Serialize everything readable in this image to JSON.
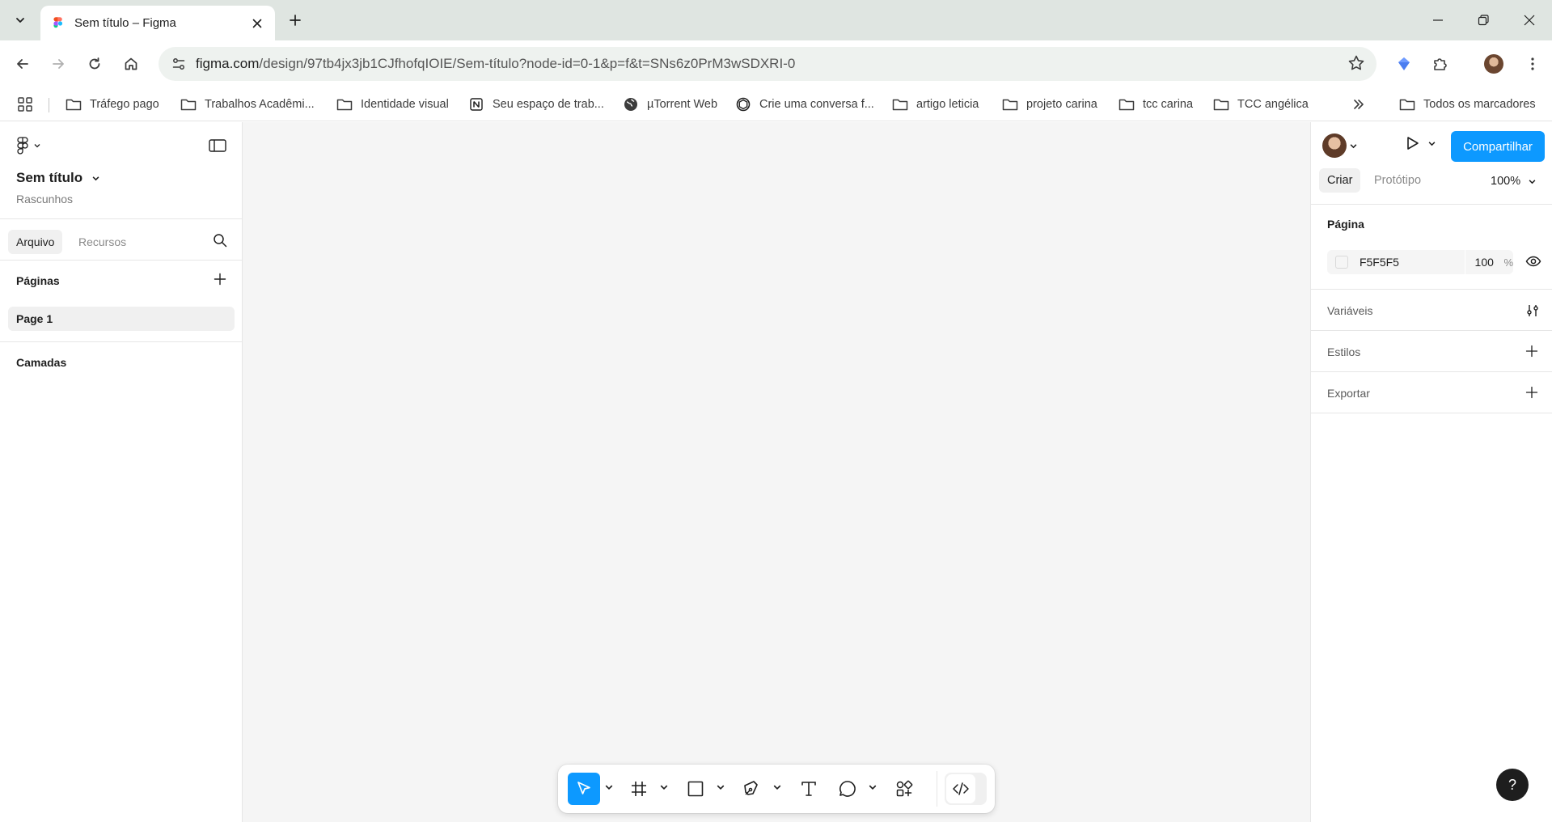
{
  "browser": {
    "tab": {
      "title": "Sem título – Figma"
    },
    "url": {
      "host": "figma.com",
      "path": "/design/97tb4jx3jb1CJfhofqIOIE/Sem-título?node-id=0-1&p=f&t=SNs6z0PrM3wSDXRI-0"
    },
    "bookmarks": [
      {
        "label": "Tráfego pago",
        "icon": "folder-icon"
      },
      {
        "label": "Trabalhos Acadêmi...",
        "icon": "folder-icon"
      },
      {
        "label": "Identidade visual",
        "icon": "folder-icon"
      },
      {
        "label": "Seu espaço de trab...",
        "icon": "notion-icon"
      },
      {
        "label": "µTorrent Web",
        "icon": "globe-icon"
      },
      {
        "label": "Crie uma conversa f...",
        "icon": "openai-icon"
      },
      {
        "label": "artigo leticia",
        "icon": "folder-icon"
      },
      {
        "label": "projeto carina",
        "icon": "folder-icon"
      },
      {
        "label": "tcc carina",
        "icon": "folder-icon"
      },
      {
        "label": "TCC angélica",
        "icon": "folder-icon"
      }
    ],
    "all_bookmarks": "Todos os marcadores"
  },
  "figma": {
    "file": {
      "title": "Sem título",
      "location": "Rascunhos"
    },
    "left_tabs": {
      "file": "Arquivo",
      "assets": "Recursos"
    },
    "pages": {
      "header": "Páginas",
      "items": [
        "Page 1"
      ]
    },
    "layers": {
      "header": "Camadas"
    },
    "right": {
      "share": "Compartilhar",
      "tabs": {
        "design": "Criar",
        "prototype": "Protótipo"
      },
      "zoom": "100%",
      "page_section": {
        "title": "Página",
        "color": "F5F5F5",
        "opacity": "100",
        "unit": "%"
      },
      "variables": "Variáveis",
      "styles": "Estilos",
      "export": "Exportar"
    },
    "help": "?",
    "colors": {
      "accent": "#0d99ff",
      "canvas": "#f5f5f5"
    }
  }
}
